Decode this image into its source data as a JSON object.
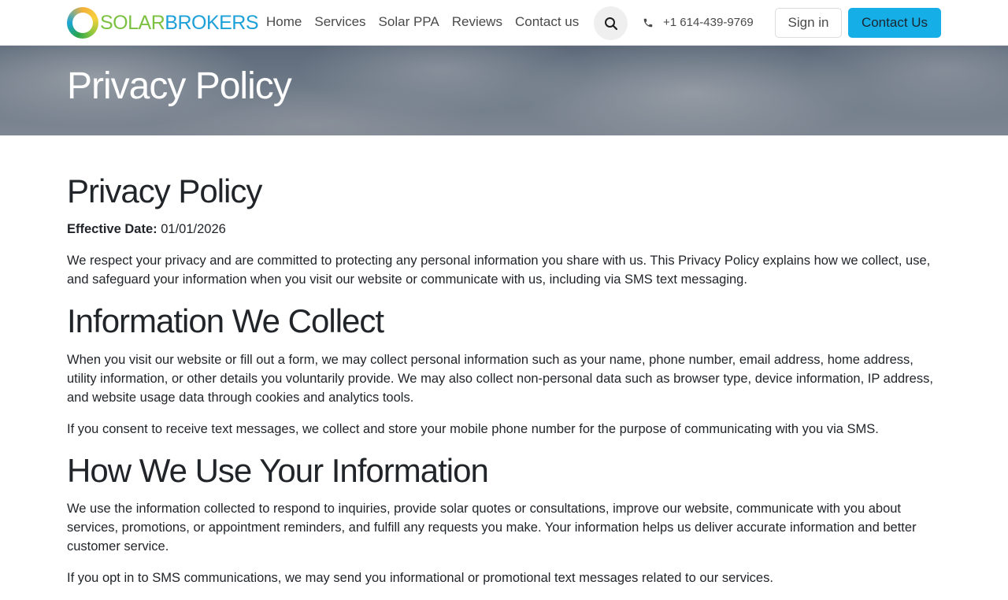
{
  "brand": {
    "part1": "SOLAR",
    "part2": "BROKERS",
    "logo_icon": "solar-ring-logo"
  },
  "nav": {
    "items": [
      {
        "label": "Home"
      },
      {
        "label": "Services"
      },
      {
        "label": "Solar PPA"
      },
      {
        "label": "Reviews"
      },
      {
        "label": "Contact us"
      }
    ]
  },
  "header": {
    "search_icon": "search-icon",
    "phone_icon": "phone-icon",
    "phone": "+1 614-439-9769",
    "signin_label": "Sign in",
    "contact_label": "Contact Us",
    "contact_color": "#16aee6"
  },
  "hero": {
    "title": "Privacy Policy"
  },
  "content": {
    "title": "Privacy Policy",
    "effective_label": "Effective Date:",
    "effective_date": "01/01/2026",
    "intro": "We respect your privacy and are committed to protecting any personal information you share with us. This Privacy Policy explains how we collect, use, and safeguard your information when you visit our website or communicate with us, including via SMS text messaging.",
    "section1_heading": "Information We Collect",
    "section1_p1": "When you visit our website or fill out a form, we may collect personal information such as your name, phone number, email address, home address, utility information, or other details you voluntarily provide. We may also collect non-personal data such as browser type, device information, IP address, and website usage data through cookies and analytics tools.",
    "section1_p2": "If you consent to receive text messages, we collect and store your mobile phone number for the purpose of communicating with you via SMS.",
    "section2_heading": "How We Use Your Information",
    "section2_p1": "We use the information collected to respond to inquiries, provide solar quotes or consultations, improve our website, communicate with you about services, promotions, or appointment reminders, and fulfill any requests you make. Your information helps us deliver accurate information and better customer service.",
    "section2_p2": "If you opt in to SMS communications, we may send you informational or promotional text messages related to our services."
  }
}
